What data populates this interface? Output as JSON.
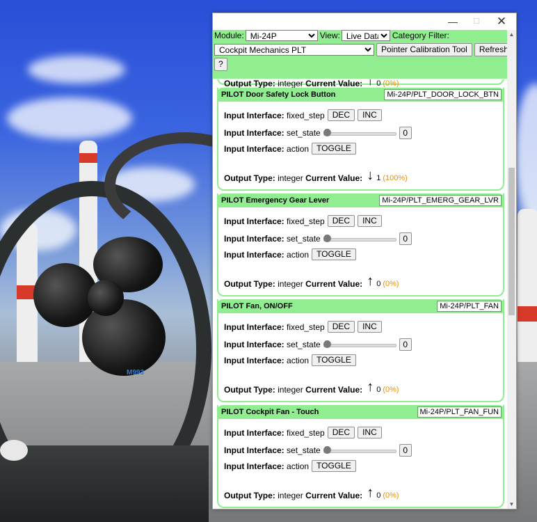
{
  "window": {
    "titlebar": {
      "minimize": "—",
      "maximize": "☐",
      "close": "✕"
    }
  },
  "toolbar": {
    "module_label": "Module:",
    "module_value": "Mi-24P",
    "view_label": "View:",
    "view_value": "Live Data",
    "category_label": "Category Filter:",
    "category_value": "Cockpit Mechanics PLT",
    "calibration_button": "Pointer Calibration Tool",
    "refresh_button": "Refresh",
    "help_button": "?"
  },
  "background": {
    "label": "M993"
  },
  "partial_top": {
    "output_type_label": "Output Type:",
    "output_type": "integer",
    "current_value_label": "Current Value:",
    "arrow": "↑",
    "value": "0",
    "percent": "(0%)"
  },
  "labels": {
    "input_interface": "Input Interface:",
    "fixed_step": "fixed_step",
    "set_state": "set_state",
    "action": "action",
    "dec": "DEC",
    "inc": "INC",
    "toggle": "TOGGLE",
    "output_type": "Output Type:",
    "current_value": "Current Value:"
  },
  "panels": [
    {
      "title": "PILOT Door Safety Lock Button",
      "id": "Mi-24P/PLT_DOOR_LOCK_BTN",
      "state_value": "0",
      "output_type": "integer",
      "arrow": "↓",
      "value": "1",
      "percent": "(100%)"
    },
    {
      "title": "PILOT Emergency Gear Lever",
      "id": "Mi-24P/PLT_EMERG_GEAR_LVR",
      "state_value": "0",
      "output_type": "integer",
      "arrow": "↑",
      "value": "0",
      "percent": "(0%)"
    },
    {
      "title": "PILOT Fan, ON/OFF",
      "id": "Mi-24P/PLT_FAN",
      "state_value": "0",
      "output_type": "integer",
      "arrow": "↑",
      "value": "0",
      "percent": "(0%)"
    },
    {
      "title": "PILOT Cockpit Fan - Touch",
      "id": "Mi-24P/PLT_FAN_FUN",
      "state_value": "0",
      "output_type": "integer",
      "arrow": "↑",
      "value": "0",
      "percent": "(0%)"
    }
  ]
}
